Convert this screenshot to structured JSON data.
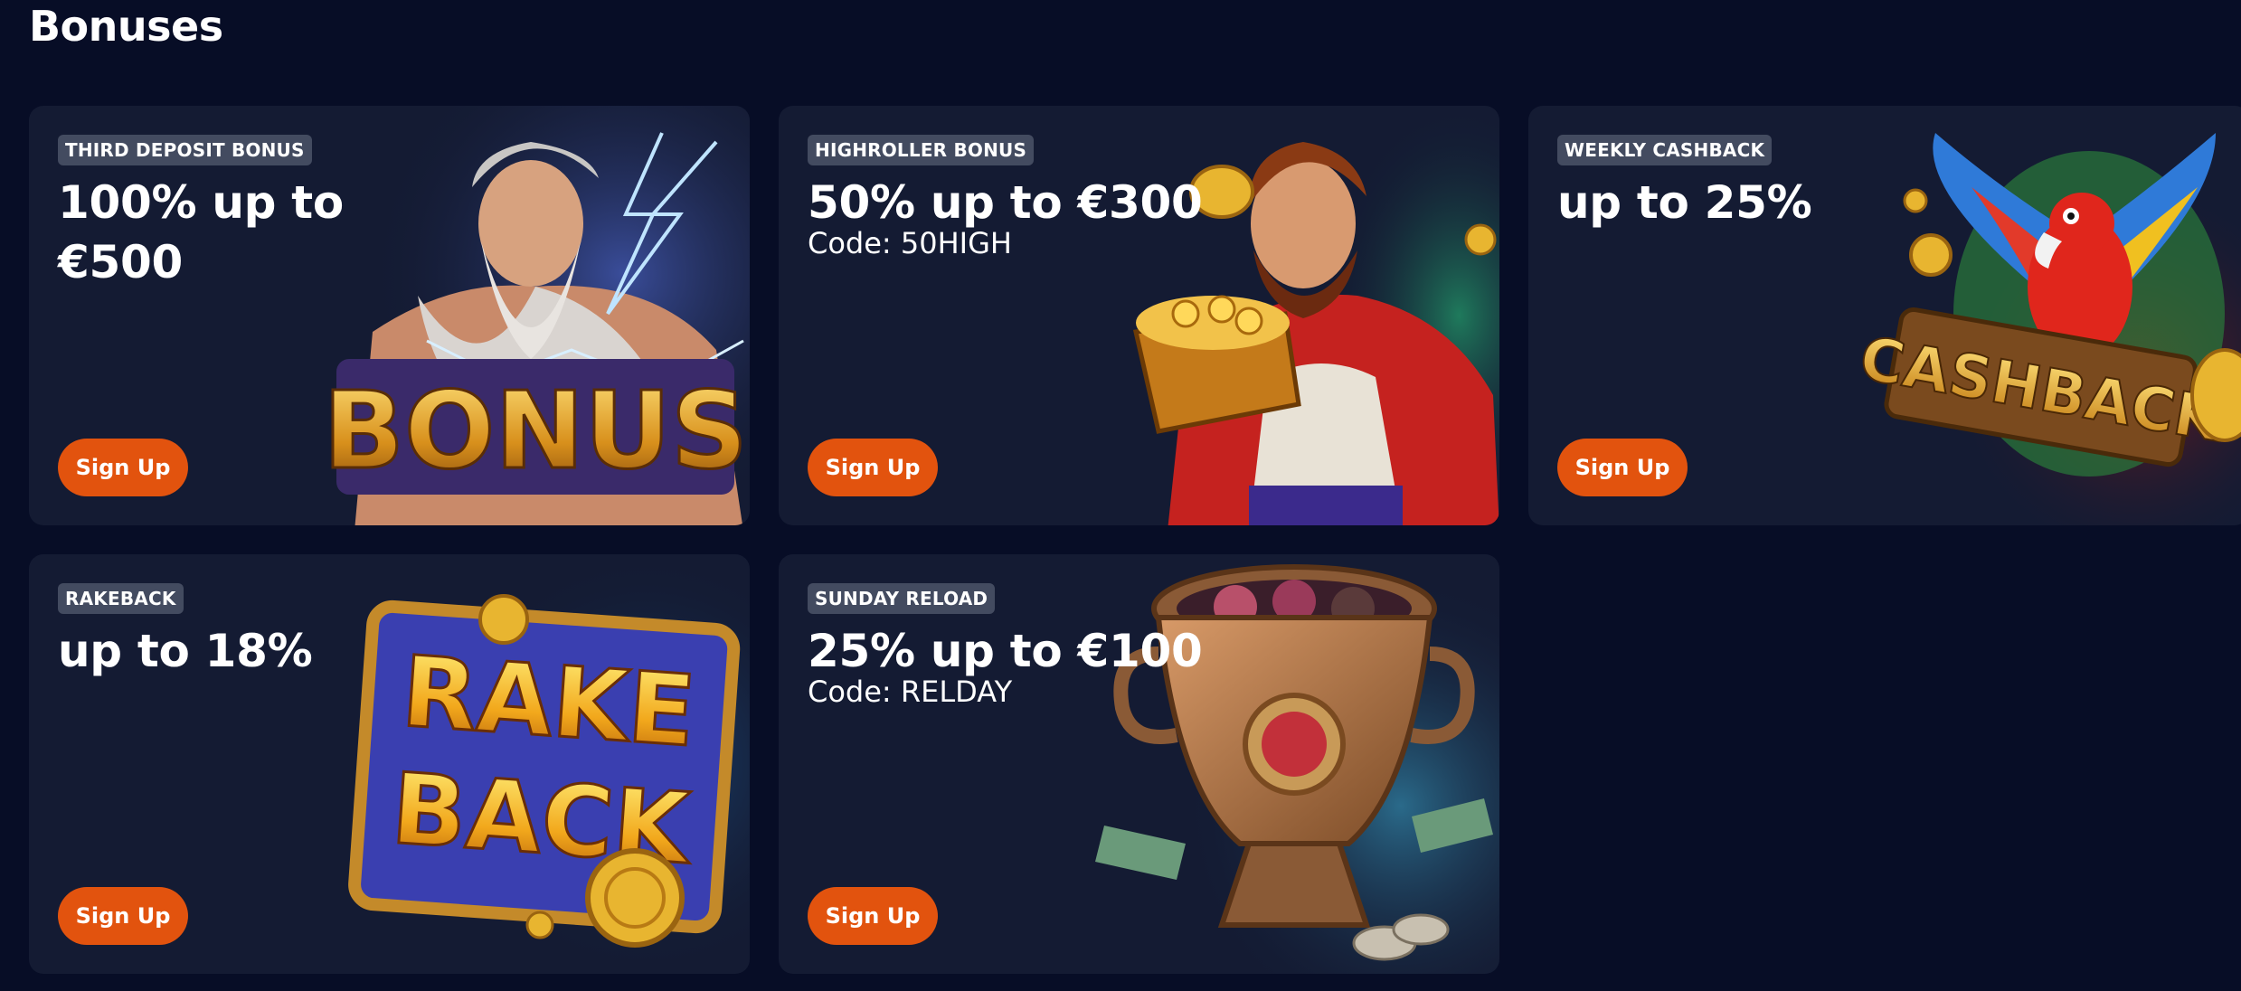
{
  "page": {
    "title": "Bonuses"
  },
  "cards": [
    {
      "badge": "THIRD DEPOSIT BONUS",
      "headline": "100% up to €500",
      "code": "",
      "cta": "Sign Up",
      "art_word": "BONUS",
      "art_icon": "zeus-bonus-illustration"
    },
    {
      "badge": "HIGHROLLER BONUS",
      "headline": "50% up to €300",
      "code": "Code: 50HIGH",
      "cta": "Sign Up",
      "art_icon": "warrior-treasure-chest-illustration"
    },
    {
      "badge": "WEEKLY CASHBACK",
      "headline": "up to 25%",
      "code": "",
      "cta": "Sign Up",
      "art_word": "CASHBACK",
      "art_icon": "parrot-cashback-illustration"
    },
    {
      "badge": "RAKEBACK",
      "headline": "up to 18%",
      "code": "",
      "cta": "Sign Up",
      "art_word_1": "RAKE",
      "art_word_2": "BACK",
      "art_icon": "rakeback-sign-illustration"
    },
    {
      "badge": "SUNDAY RELOAD",
      "headline": "25% up to €100",
      "code": "Code: RELDAY",
      "cta": "Sign Up",
      "art_icon": "treasure-urn-illustration"
    }
  ],
  "colors": {
    "page_bg": "#070d26",
    "card_bg": "#141b33",
    "badge_bg": "#434b60",
    "button_bg": "#e2530e",
    "gold": "#f2b524"
  }
}
